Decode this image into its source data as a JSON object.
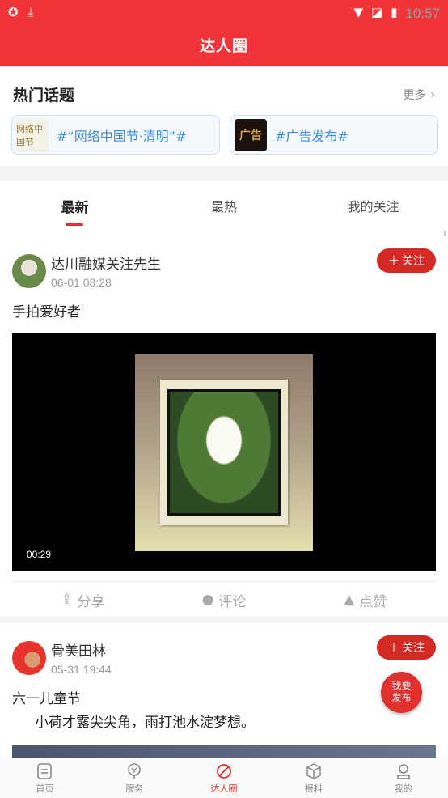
{
  "status": {
    "time": "10:57"
  },
  "header": {
    "title": "达人圈"
  },
  "hot": {
    "title": "热门话题",
    "more": "更多",
    "topics": [
      {
        "label": "#“网络中国节·清明”#",
        "thumb": "网络中国节"
      },
      {
        "label": "#广告发布#",
        "thumb": "广告"
      }
    ]
  },
  "tabs": [
    "最新",
    "最热",
    "我的关注"
  ],
  "posts": [
    {
      "author": "达川融媒关注先生",
      "time": "06-01 08:28",
      "follow": "关注",
      "text": "手拍爱好者",
      "video_duration": "00:29",
      "actions": [
        "分享",
        "评论",
        "点赞"
      ]
    },
    {
      "author": "骨美田林",
      "time": "05-31 19:44",
      "follow": "关注",
      "text": "六一儿童节",
      "text2": "小荷才露尖尖角，雨打池水淀梦想。"
    }
  ],
  "fab": {
    "line1": "我要",
    "line2": "发布"
  },
  "nav": [
    "首页",
    "服务",
    "达人圈",
    "报料",
    "我的"
  ],
  "colors": {
    "brand": "#f0343a",
    "follow": "#d42a25",
    "topic_text": "#3a8de0"
  }
}
